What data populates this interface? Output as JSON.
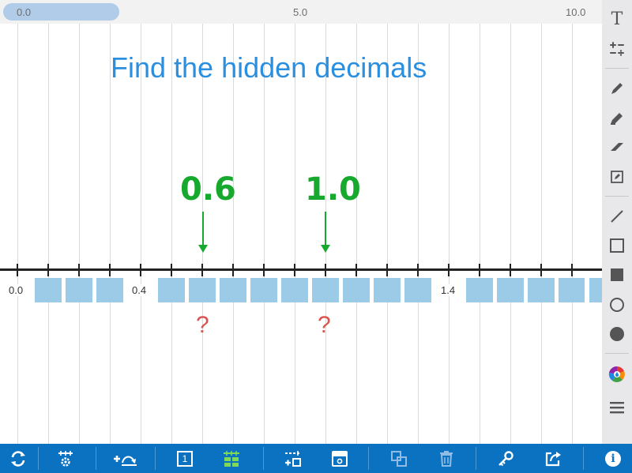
{
  "scale_bar": {
    "start_label": "0.0",
    "mid_label": "5.0",
    "end_label": "10.0"
  },
  "title": "Find the hidden decimals",
  "number_line": {
    "visible_labels": [
      "0.0",
      "0.4",
      "1.4"
    ],
    "hidden_marks": 15
  },
  "annotations": {
    "answer_1": "0.6",
    "answer_2": "1.0",
    "question_1": "?",
    "question_2": "?"
  },
  "colors": {
    "title": "#2b8fe0",
    "handwriting": "#17a82e",
    "question": "#d9534f",
    "mark_box": "#9ccbe8",
    "toolbar": "#0b72c2"
  },
  "right_toolbar": {
    "items": [
      "text-icon",
      "operations-icon",
      "pen-icon",
      "highlighter-icon",
      "eraser-icon",
      "note-icon",
      "line-icon",
      "rectangle-outline-icon",
      "rectangle-filled-icon",
      "circle-outline-icon",
      "circle-filled-icon",
      "color-picker-icon",
      "menu-icon"
    ],
    "text_tool_glyph": "T"
  },
  "bottom_toolbar": {
    "items": [
      "reset-icon",
      "settings-icon",
      "add-jump-icon",
      "single-number-icon",
      "grid-marks-icon",
      "add-mark-icon",
      "hide-icon",
      "duplicate-icon",
      "trash-icon",
      "key-icon",
      "share-icon",
      "info-icon"
    ],
    "single_number_glyph": "1",
    "info_glyph": "i"
  }
}
